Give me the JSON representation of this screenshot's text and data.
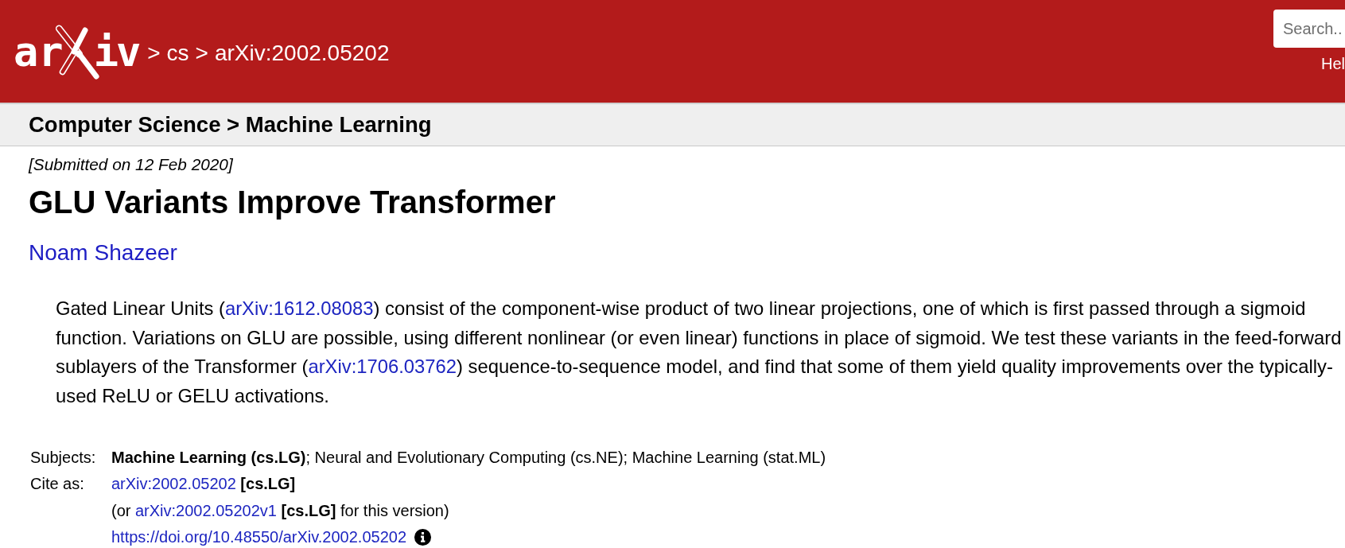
{
  "header": {
    "logo": {
      "left": "ar",
      "right": "iv"
    },
    "breadcrumb": [
      {
        "separator": ">",
        "label": "cs"
      },
      {
        "separator": ">",
        "label": "arXiv:2002.05202"
      }
    ],
    "search": {
      "placeholder": "Search.."
    },
    "help_link": "Hel"
  },
  "category_bar": "Computer Science > Machine Learning",
  "paper": {
    "submitted": "[Submitted on 12 Feb 2020]",
    "title": "GLU Variants Improve Transformer",
    "authors": [
      "Noam Shazeer"
    ],
    "abstract": [
      {
        "kind": "text",
        "text": "Gated Linear Units ("
      },
      {
        "kind": "link",
        "text": "arXiv:1612.08083"
      },
      {
        "kind": "text",
        "text": ") consist of the component-wise product of two linear projections, one of which is first passed through a sigmoid function. Variations on GLU are possible, using different nonlinear (or even linear) functions in place of sigmoid. We test these variants in the feed-forward sublayers of the Transformer ("
      },
      {
        "kind": "link",
        "text": "arXiv:1706.03762"
      },
      {
        "kind": "text",
        "text": ") sequence-to-sequence model, and find that some of them yield quality improvements over the typically-used ReLU or GELU activations."
      }
    ]
  },
  "metadata": [
    {
      "label": "Subjects:",
      "lines": [
        {
          "parts": [
            {
              "kind": "text",
              "text": "**Machine Learning (cs.LG)**; Neural and Evolutionary Computing (cs.NE); Machine Learning (stat.ML)"
            }
          ],
          "info_icon": false
        }
      ]
    },
    {
      "label": "Cite as:",
      "lines": [
        {
          "parts": [
            {
              "kind": "link",
              "text": "arXiv:2002.05202"
            },
            {
              "kind": "text",
              "text": " **[cs.LG]**"
            }
          ],
          "info_icon": false
        },
        {
          "parts": [
            {
              "kind": "text",
              "text": "(or "
            },
            {
              "kind": "link",
              "text": "arXiv:2002.05202v1"
            },
            {
              "kind": "text",
              "text": " **[cs.LG]** for this version)"
            }
          ],
          "info_icon": false
        },
        {
          "parts": [
            {
              "kind": "link",
              "text": "https://doi.org/10.48550/arXiv.2002.05202"
            }
          ],
          "info_icon": true
        }
      ]
    }
  ]
}
